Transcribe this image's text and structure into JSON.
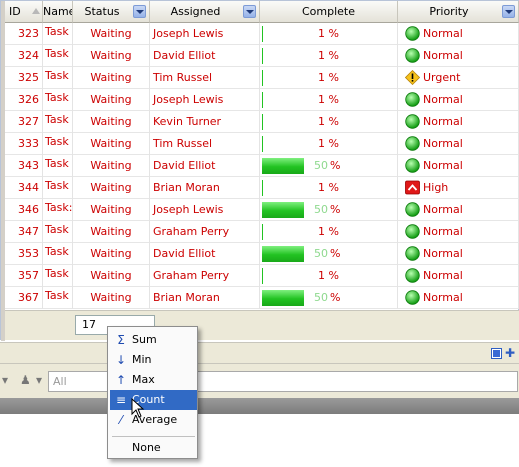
{
  "columns": {
    "id": "ID",
    "name": "Name",
    "status": "Status",
    "assigned": "Assigned",
    "complete": "Complete",
    "priority": "Priority"
  },
  "rows": [
    {
      "id": "323",
      "name": "Task",
      "status": "Waiting",
      "assigned": "Joseph Lewis",
      "complete": "1 %",
      "progress": 1,
      "priority": "Normal",
      "priority_icon": "green-circle-icon"
    },
    {
      "id": "324",
      "name": "Task",
      "status": "Waiting",
      "assigned": "David Elliot",
      "complete": "1 %",
      "progress": 1,
      "priority": "Normal",
      "priority_icon": "green-circle-icon"
    },
    {
      "id": "325",
      "name": "Task",
      "status": "Waiting",
      "assigned": "Tim Russel",
      "complete": "1 %",
      "progress": 1,
      "priority": "Urgent",
      "priority_icon": "warning-diamond-icon"
    },
    {
      "id": "326",
      "name": "Task",
      "status": "Waiting",
      "assigned": "Joseph Lewis",
      "complete": "1 %",
      "progress": 1,
      "priority": "Normal",
      "priority_icon": "green-circle-icon"
    },
    {
      "id": "327",
      "name": "Task",
      "status": "Waiting",
      "assigned": "Kevin Turner",
      "complete": "1 %",
      "progress": 1,
      "priority": "Normal",
      "priority_icon": "green-circle-icon"
    },
    {
      "id": "333",
      "name": "Task",
      "status": "Waiting",
      "assigned": "Tim Russel",
      "complete": "1 %",
      "progress": 1,
      "priority": "Normal",
      "priority_icon": "green-circle-icon"
    },
    {
      "id": "343",
      "name": "Task",
      "status": "Waiting",
      "assigned": "David Elliot",
      "complete": "%",
      "bar_label": "50",
      "progress": 50,
      "priority": "Normal",
      "priority_icon": "green-circle-icon"
    },
    {
      "id": "344",
      "name": "Task",
      "status": "Waiting",
      "assigned": "Brian Moran",
      "complete": "1 %",
      "progress": 1,
      "priority": "High",
      "priority_icon": "high-priority-icon"
    },
    {
      "id": "346",
      "name": "Task:",
      "status": "Waiting",
      "assigned": "Joseph Lewis",
      "complete": "%",
      "bar_label": "50",
      "progress": 50,
      "priority": "Normal",
      "priority_icon": "green-circle-icon"
    },
    {
      "id": "347",
      "name": "Task",
      "status": "Waiting",
      "assigned": "Graham Perry",
      "complete": "1 %",
      "progress": 1,
      "priority": "Normal",
      "priority_icon": "green-circle-icon"
    },
    {
      "id": "353",
      "name": "Task",
      "status": "Waiting",
      "assigned": "David Elliot",
      "complete": "%",
      "bar_label": "50",
      "progress": 50,
      "priority": "Normal",
      "priority_icon": "green-circle-icon"
    },
    {
      "id": "357",
      "name": "Task",
      "status": "Waiting",
      "assigned": "Graham Perry",
      "complete": "1 %",
      "progress": 1,
      "priority": "Normal",
      "priority_icon": "green-circle-icon"
    },
    {
      "id": "367",
      "name": "Task",
      "status": "Waiting",
      "assigned": "Brian Moran",
      "complete": "%",
      "bar_label": "50",
      "progress": 50,
      "priority": "Normal",
      "priority_icon": "green-circle-icon"
    }
  ],
  "footer": {
    "count_value": "17"
  },
  "filter": {
    "value": "All"
  },
  "menu": {
    "items": [
      {
        "label": "Sum",
        "icon": "sigma-icon"
      },
      {
        "label": "Min",
        "icon": "min-icon"
      },
      {
        "label": "Max",
        "icon": "max-icon"
      },
      {
        "label": "Count",
        "icon": "count-icon",
        "selected": true
      },
      {
        "label": "Average",
        "icon": "average-icon"
      },
      {
        "label": "None",
        "icon": ""
      }
    ]
  },
  "colors": {
    "text_red": "#cc0000",
    "bar_green": "#22c322",
    "menu_highlight": "#316ac5",
    "header_bg": "#e4e2d8"
  }
}
